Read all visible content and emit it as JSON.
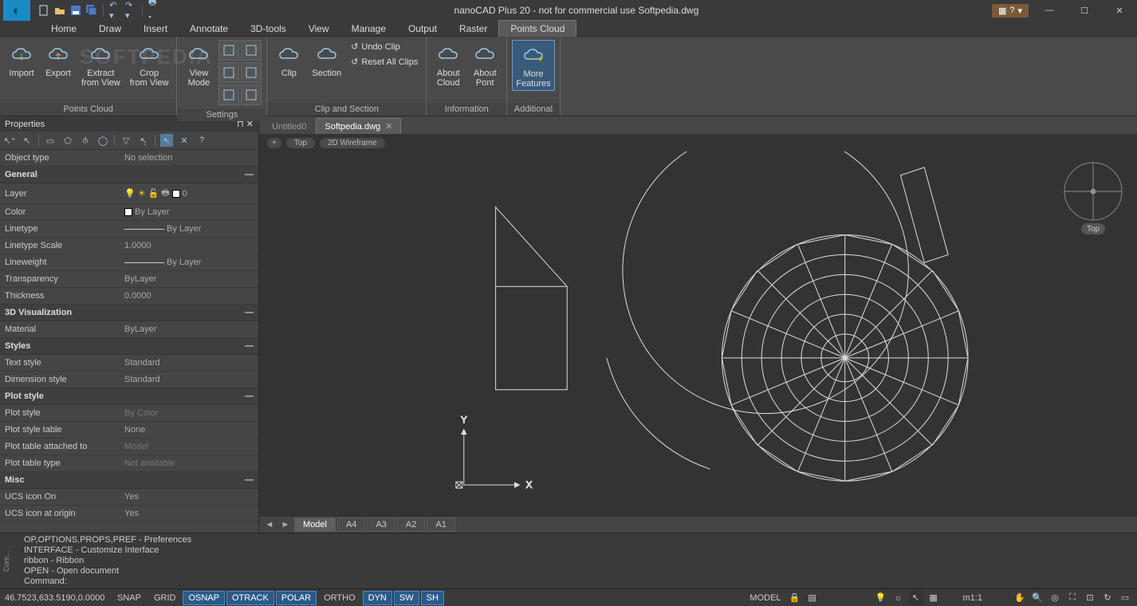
{
  "title": "nanoCAD Plus 20 - not for commercial use Softpedia.dwg",
  "help_label": "?",
  "menubar": [
    "Home",
    "Draw",
    "Insert",
    "Annotate",
    "3D-tools",
    "View",
    "Manage",
    "Output",
    "Raster",
    "Points Cloud"
  ],
  "menubar_active": 9,
  "ribbon": {
    "groups": [
      {
        "label": "Points Cloud",
        "buttons": [
          {
            "name": "import",
            "label": "Import"
          },
          {
            "name": "export",
            "label": "Export"
          },
          {
            "name": "extract-from-view",
            "label": "Extract\nfrom View"
          },
          {
            "name": "crop-from-view",
            "label": "Crop\nfrom View"
          }
        ]
      },
      {
        "label": "Settings",
        "buttons": [
          {
            "name": "view-mode",
            "label": "View\nMode"
          }
        ]
      },
      {
        "label": "Clip and Section",
        "buttons": [
          {
            "name": "clip",
            "label": "Clip"
          },
          {
            "name": "section",
            "label": "Section"
          }
        ],
        "small": [
          {
            "name": "undo-clip",
            "label": "Undo Clip"
          },
          {
            "name": "reset-all-clips",
            "label": "Reset All Clips"
          }
        ]
      },
      {
        "label": "Information",
        "buttons": [
          {
            "name": "about-cloud",
            "label": "About\nCloud"
          },
          {
            "name": "about-pont",
            "label": "About\nPont"
          }
        ]
      },
      {
        "label": "Additional",
        "buttons": [
          {
            "name": "more-features",
            "label": "More\nFeatures",
            "selected": true
          }
        ]
      }
    ]
  },
  "watermark": "SOFTPEDIA",
  "properties": {
    "title": "Properties",
    "object_type_label": "Object type",
    "object_type_value": "No selection",
    "sections": [
      {
        "title": "General",
        "rows": [
          {
            "label": "Layer",
            "value": "0",
            "layer_icons": true
          },
          {
            "label": "Color",
            "value": "By Layer",
            "swatch": true
          },
          {
            "label": "Linetype",
            "value": "By Layer",
            "line": true
          },
          {
            "label": "Linetype Scale",
            "value": "1.0000"
          },
          {
            "label": "Lineweight",
            "value": "By Layer",
            "line": true
          },
          {
            "label": "Transparency",
            "value": "ByLayer"
          },
          {
            "label": "Thickness",
            "value": "0.0000"
          }
        ]
      },
      {
        "title": "3D Visualization",
        "rows": [
          {
            "label": "Material",
            "value": "ByLayer"
          }
        ]
      },
      {
        "title": "Styles",
        "rows": [
          {
            "label": "Text style",
            "value": "Standard"
          },
          {
            "label": "Dimension style",
            "value": "Standard"
          }
        ]
      },
      {
        "title": "Plot style",
        "rows": [
          {
            "label": "Plot style",
            "value": "By Color",
            "dim": true
          },
          {
            "label": "Plot style table",
            "value": "None"
          },
          {
            "label": "Plot table attached to",
            "value": "Model",
            "dim": true
          },
          {
            "label": "Plot table type",
            "value": "Not available",
            "dim": true
          }
        ]
      },
      {
        "title": "Misc",
        "rows": [
          {
            "label": "UCS icon On",
            "value": "Yes"
          },
          {
            "label": "UCS icon at origin",
            "value": "Yes"
          }
        ]
      }
    ]
  },
  "doc_tabs": [
    {
      "label": "Untitled0",
      "active": false
    },
    {
      "label": "Softpedia.dwg",
      "active": true
    }
  ],
  "view_chips": [
    "+",
    "Top",
    "2D Wireframe"
  ],
  "compass_label": "Top",
  "axis": {
    "x": "X",
    "y": "Y"
  },
  "layout_tabs": [
    "Model",
    "A4",
    "A3",
    "A2",
    "A1"
  ],
  "layout_active": 0,
  "cmdline": [
    "OP,OPTIONS,PROPS,PREF - Preferences",
    "INTERFACE - Customize Interface",
    "ribbon - Ribbon",
    "OPEN - Open document",
    "Command:"
  ],
  "cmd_sidelabel": "Com...",
  "status": {
    "coords": "46.7523,633.5190,0.0000",
    "toggles": [
      {
        "label": "SNAP",
        "on": false
      },
      {
        "label": "GRID",
        "on": false
      },
      {
        "label": "OSNAP",
        "on": true
      },
      {
        "label": "OTRACK",
        "on": true
      },
      {
        "label": "POLAR",
        "on": true
      },
      {
        "label": "ORTHO",
        "on": false
      },
      {
        "label": "DYN",
        "on": true
      },
      {
        "label": "SW",
        "on": true
      },
      {
        "label": "SH",
        "on": true
      }
    ],
    "model_label": "MODEL",
    "scale": "m1:1"
  }
}
